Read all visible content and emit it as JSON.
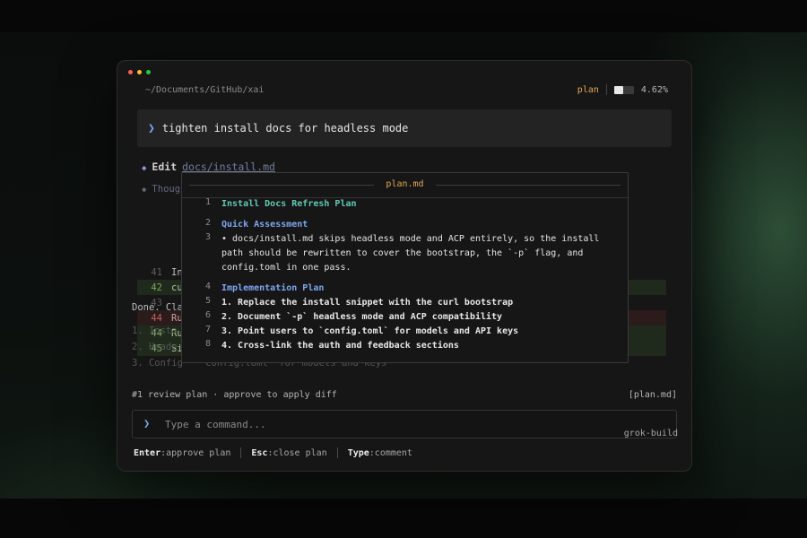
{
  "window": {
    "path": "~/Documents/GitHub/xai",
    "mode": "plan",
    "context_percent": "4.62%",
    "context_fill": 0.462
  },
  "prompt": {
    "text": "tighten install docs for headless mode"
  },
  "transcript": {
    "edit_verb": "Edit",
    "edit_file": "docs/install.md",
    "thought_label": "Thoug",
    "diff_rows": [
      {
        "ln": "41",
        "text": "In"
      },
      {
        "ln": "42",
        "text": "cu"
      },
      {
        "ln": "43",
        "text": ""
      },
      {
        "ln": "44",
        "text": "Ru"
      },
      {
        "ln": "44",
        "text": "Ru"
      },
      {
        "ln": "45",
        "text": "Si"
      }
    ],
    "done_text": "Done. Cla",
    "list": [
      "1. Insta",
      "2. Heade",
      "3. Config · `config.toml` for models and keys"
    ]
  },
  "modal": {
    "title": "plan.md",
    "lines": [
      {
        "ln": "1",
        "text": "Install Docs Refresh Plan"
      },
      {
        "ln": "2",
        "text": "Quick Assessment"
      },
      {
        "ln": "3",
        "text": "• docs/install.md skips headless mode and ACP entirely, so the install path should be rewritten to cover the bootstrap, the `-p` flag, and config.toml in one pass."
      },
      {
        "ln": "4",
        "text": "Implementation Plan"
      },
      {
        "ln": "5",
        "text": "1. Replace the install snippet with the curl bootstrap"
      },
      {
        "ln": "6",
        "text": "2. Document `-p` headless mode and ACP compatibility"
      },
      {
        "ln": "7",
        "text": "3. Point users to `config.toml` for models and API keys"
      },
      {
        "ln": "8",
        "text": "4. Cross-link the auth and feedback sections"
      }
    ]
  },
  "review": {
    "status": "#1 review plan · approve to apply diff",
    "tag": "[plan.md]"
  },
  "command": {
    "placeholder": "Type a command...",
    "brand": "grok-build"
  },
  "hints": [
    {
      "key": "Enter",
      "desc": ":approve plan"
    },
    {
      "key": "Esc",
      "desc": ":close plan"
    },
    {
      "key": "Type",
      "desc": ":comment"
    }
  ],
  "colors": {
    "accent_orange": "#e2a653",
    "accent_blue": "#7ea6f0",
    "accent_teal": "#5fc9b8"
  }
}
